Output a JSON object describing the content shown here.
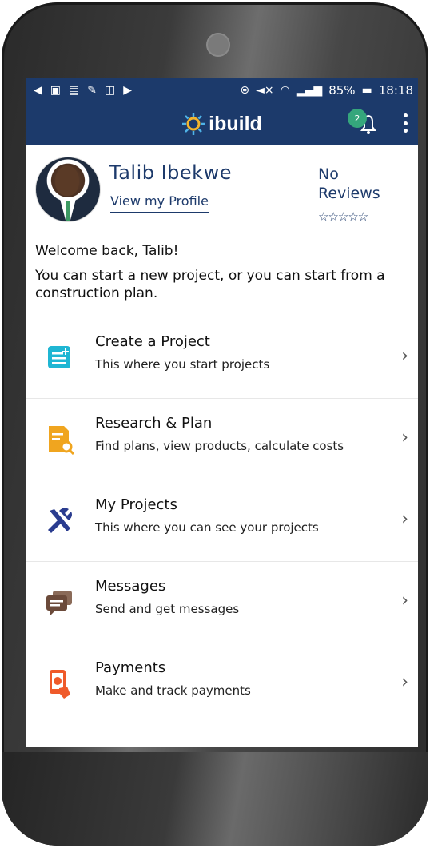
{
  "status_bar": {
    "battery": "85%",
    "time": "18:18"
  },
  "app_bar": {
    "logo_text": "ibuild",
    "notification_count": "2"
  },
  "profile": {
    "name": "Talib Ibekwe",
    "view_profile": "View my Profile",
    "reviews_label": "No Reviews",
    "stars": "☆☆☆☆☆"
  },
  "welcome": {
    "greeting": "Welcome back, Talib!",
    "message": "You can start a new project, or you can start from a construction plan."
  },
  "menu": {
    "items": [
      {
        "title": "Create a Project",
        "subtitle": "This where you start projects",
        "icon": "document-add-icon",
        "color": "#1fb6d3"
      },
      {
        "title": "Research & Plan",
        "subtitle": "Find plans, view products, calculate costs",
        "icon": "document-search-icon",
        "color": "#f0a51f"
      },
      {
        "title": "My Projects",
        "subtitle": "This where you can see your projects",
        "icon": "tools-icon",
        "color": "#2a3c8f"
      },
      {
        "title": "Messages",
        "subtitle": "Send and get messages",
        "icon": "chat-bubbles-icon",
        "color": "#6b4a3a"
      },
      {
        "title": "Payments",
        "subtitle": "Make and track payments",
        "icon": "payment-phone-icon",
        "color": "#ef5a2a"
      }
    ]
  },
  "colors": {
    "header": "#1c3a6b",
    "text_primary": "#1d3a6b",
    "badge": "#35a67c"
  }
}
